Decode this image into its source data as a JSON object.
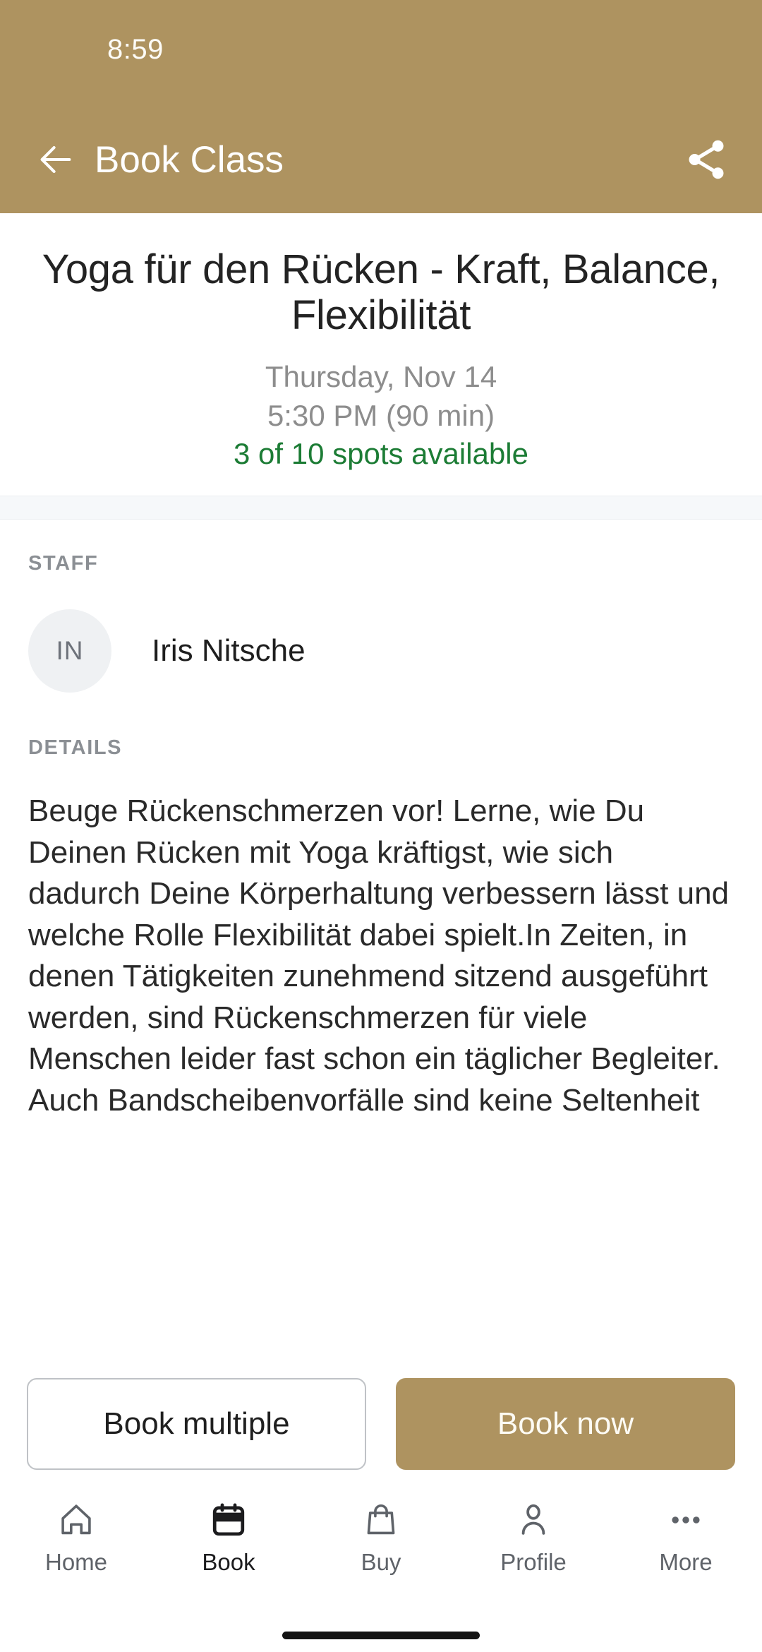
{
  "status_bar": {
    "time": "8:59"
  },
  "app_bar": {
    "back_icon": "back-arrow-icon",
    "title": "Book Class",
    "share_icon": "share-icon"
  },
  "hero": {
    "class_title": "Yoga für den Rücken - Kraft, Balance, Flexibilität",
    "date": "Thursday, Nov 14",
    "time": "5:30 PM (90 min)",
    "spots": "3 of 10 spots available"
  },
  "staff": {
    "section_label": "STAFF",
    "avatar_initials": "IN",
    "name": "Iris Nitsche"
  },
  "details": {
    "section_label": "DETAILS",
    "text": "Beuge Rückenschmerzen vor! Lerne, wie Du Deinen Rücken mit Yoga kräftigst, wie sich dadurch Deine Körperhaltung verbessern lässt und welche Rolle Flexibilität dabei spielt.In Zeiten, in denen Tätigkeiten zunehmend sitzend ausgeführt werden, sind Rückenschmerzen für viele Menschen leider fast schon ein täglicher Begleiter. Auch Bandscheibenvorfälle sind keine Seltenheit"
  },
  "actions": {
    "book_multiple_label": "Book multiple",
    "book_now_label": "Book now"
  },
  "bottom_nav": {
    "items": [
      {
        "label": "Home",
        "icon": "home-icon",
        "active": false
      },
      {
        "label": "Book",
        "icon": "calendar-icon",
        "active": true
      },
      {
        "label": "Buy",
        "icon": "shopping-bag-icon",
        "active": false
      },
      {
        "label": "Profile",
        "icon": "person-icon",
        "active": false
      },
      {
        "label": "More",
        "icon": "ellipsis-icon",
        "active": false
      }
    ]
  },
  "colors": {
    "brand": "#AE9360",
    "available_green": "#1C7C35",
    "avatar_bg": "#EFF1F3",
    "divider": "#F6F8FA",
    "nav_inactive": "#5F6369",
    "nav_active": "#1C1C1E"
  }
}
